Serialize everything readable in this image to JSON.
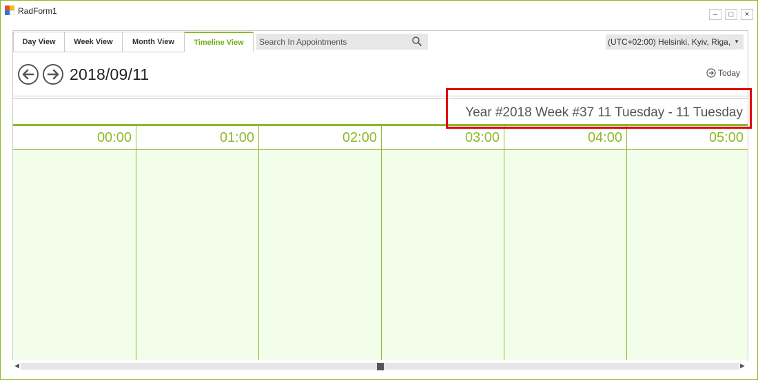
{
  "window": {
    "title": "RadForm1",
    "controls": [
      "–",
      "□",
      "×"
    ]
  },
  "tabs": [
    {
      "label": "Day View",
      "active": false
    },
    {
      "label": "Week View",
      "active": false
    },
    {
      "label": "Month View",
      "active": false
    },
    {
      "label": "Timeline View",
      "active": true
    }
  ],
  "search": {
    "placeholder": "Search In Appointments",
    "value": ""
  },
  "timezone": {
    "value": "(UTC+02:00) Helsinki, Kyiv, Riga,"
  },
  "navigation": {
    "date": "2018/09/11",
    "today_label": "Today"
  },
  "header": {
    "range": "Year #2018 Week #37 11 Tuesday - 11 Tuesday"
  },
  "timeline": {
    "hours": [
      "00:00",
      "01:00",
      "02:00",
      "03:00",
      "04:00",
      "05:00"
    ]
  },
  "colors": {
    "accent": "#8dba2a",
    "cell_background": "#f2fdea",
    "highlight": "#e00000"
  }
}
